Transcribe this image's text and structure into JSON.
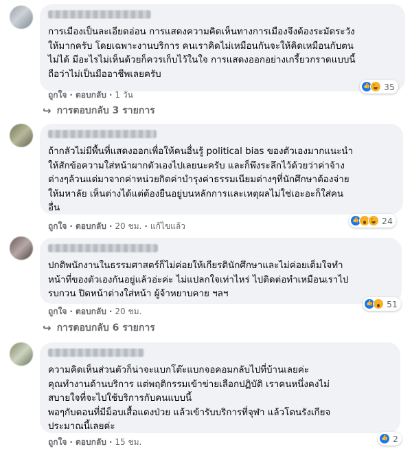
{
  "comments": [
    {
      "text": "การเมืองเป็นละเอียดอ่อน การแสดงความคิดเห็นทางการเมืองจึงต้องระมัดระวัง\nให้มากครับ โดยเฉพาะงานบริการ คนเราคิดไม่เหมือนกันจะให้คิดเหมือนกับตน\nไม่ได้ มีอะไรไม่เห็นด้วยก็ควรเก็บไว้ในใจ การแสดงออกอย่างเกรี้ยวกราดแบบนี้\nถือว่าไม่เป็นมืออาชีพเลยครับ",
      "like": "ถูกใจ",
      "reply": "ตอบกลับ",
      "time": "1 วัน",
      "reaction_count": "35",
      "reaction_icons": [
        "like-icon",
        "haha-icon"
      ],
      "replies_label": "การตอบกลับ 3 รายการ"
    },
    {
      "text": "ถ้ากลัวไม่มีพื้นที่แสดงออกเพื่อให้คนอื่นรู้ political bias ของตัวเองมากแนะนำ\nให้สักข้อความใส่หน้าผากตัวเองไปเลยนะครับ และก็พึงระลึกไว้ด้วยว่าค่าจ้าง\nต่างๆล้วนแต่มาจากค่าหน่วยกิตค่าบำรุงค่าธรรมเนียมต่างๆที่นักศึกษาต้องจ่าย\nให้มหาลัย เห็นต่างได้แต่ต้องยืนอยู่บนหลักการและเหตุผลไม่ใช่เอะอะก็ใส่คน\nอื่น",
      "like": "ถูกใจ",
      "reply": "ตอบกลับ",
      "time": "20 ชม.",
      "edited": "แก้ไขแล้ว",
      "reaction_count": "24",
      "reaction_icons": [
        "like-icon",
        "wow-icon",
        "haha-icon"
      ]
    },
    {
      "text": "ปกติพนักงานในธรรมศาสตร์ก็ไม่ค่อยให้เกียรตินักศึกษาและไม่ค่อยเต็มใจทำ\nหน้าที่ของตัวเองกันอยู่แล้วอ่ะค่ะ ไม่แปลกใจเท่าไหร่ ไปติดต่อทำเหมือนเราไป\nรบกวน ปิดหน้าต่างใส่หน้า ผู้จ้าหยาบคาย ฯลฯ",
      "like": "ถูกใจ",
      "reply": "ตอบกลับ",
      "time": "20 ชม.",
      "reaction_count": "51",
      "reaction_icons": [
        "like-icon",
        "wow-icon"
      ],
      "replies_label": "การตอบกลับ 6 รายการ"
    },
    {
      "text": "ความคิดเห็นส่วนตัวก็น่าจะแบกโต๊ะแบกจอคอมกลับไปที่บ้านเลยค่ะ\nคุณทำงานด้านบริการ แต่พฤติกรรมเข้าข่ายเลือกปฏิบัติ เราคนหนึ่งคงไม่\nสบายใจที่จะไปใช้บริการกับคนแบบนี้\nพอๆกับตอนที่มีม็อบเสื้อแดงป่วย แล้วเข้ารับบริการที่จุฬา แล้วโดนรังเกียจ\nประมาณนี้เลยค่ะ",
      "like": "ถูกใจ",
      "reply": "ตอบกลับ",
      "time": "15 ชม.",
      "reaction_count": "2",
      "reaction_icons": [
        "like-icon"
      ]
    }
  ],
  "colors": {
    "bubble": "#f0f2f5",
    "meta": "#65676b",
    "like_blue": "#1877f2",
    "emoji_yellow": "#f7b125"
  }
}
